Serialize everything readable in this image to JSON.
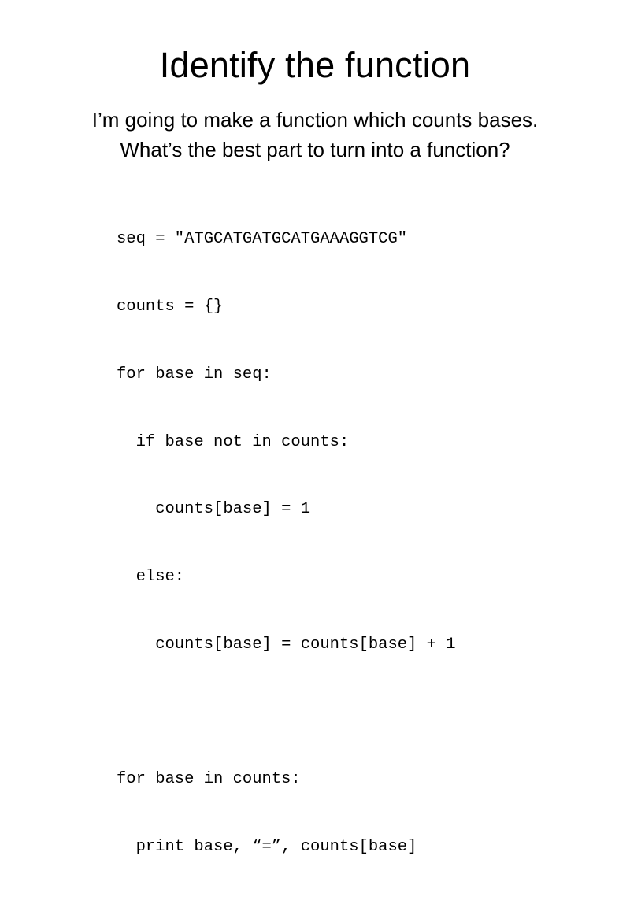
{
  "slide": {
    "title": "Identify the function",
    "subtitle_lines": [
      "I’m going to make a function which counts bases.",
      "What’s the best part to turn into a function?"
    ],
    "code_lines": [
      "seq = \"ATGCATGATGCATGAAAGGTCG\"",
      "counts = {}",
      "for base in seq:",
      "  if base not in counts:",
      "    counts[base] = 1",
      "  else:",
      "    counts[base] = counts[base] + 1",
      "",
      "for base in counts:",
      "  print base, “=”, counts[base]"
    ]
  }
}
